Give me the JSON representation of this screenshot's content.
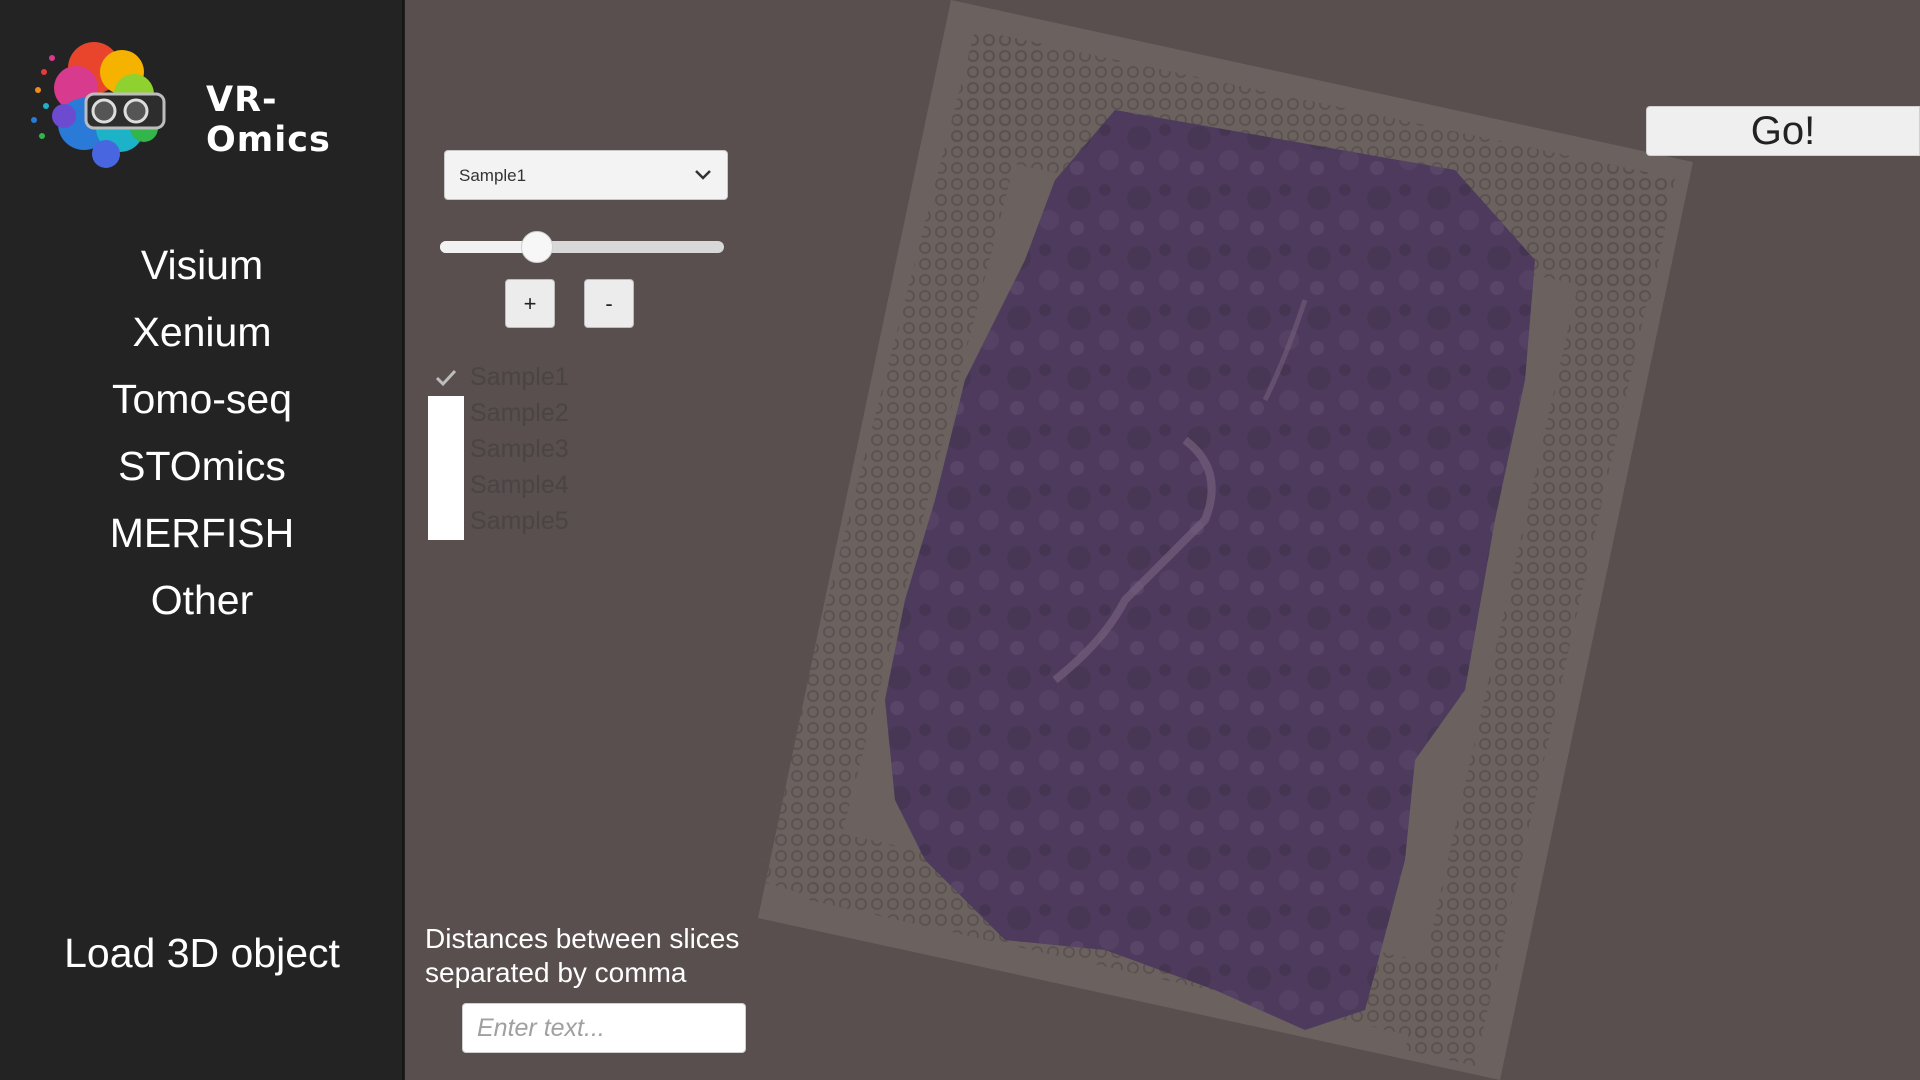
{
  "app": {
    "title": "VR-Omics",
    "logo_icon": "brain-vr-headset-logo-icon"
  },
  "sidebar": {
    "items": [
      {
        "label": "Visium"
      },
      {
        "label": "Xenium"
      },
      {
        "label": "Tomo-seq"
      },
      {
        "label": "STOmics"
      },
      {
        "label": "MERFISH"
      },
      {
        "label": "Other"
      }
    ],
    "load_label": "Load 3D object"
  },
  "controls": {
    "dropdown": {
      "selected": "Sample1",
      "icon": "chevron-down-icon"
    },
    "slider": {
      "value_fraction": 0.34
    },
    "plus_label": "+",
    "minus_label": "-",
    "samples": [
      {
        "label": "Sample1",
        "checked": true
      },
      {
        "label": "Sample2",
        "checked": false
      },
      {
        "label": "Sample3",
        "checked": false
      },
      {
        "label": "Sample4",
        "checked": false
      },
      {
        "label": "Sample5",
        "checked": false
      }
    ],
    "distances_label_line1": "Distances between slices",
    "distances_label_line2": "separated by comma",
    "distances_input": {
      "value": "",
      "placeholder": "Enter text..."
    },
    "go_label": "Go!"
  },
  "colors": {
    "sidebar_bg": "#232323",
    "main_bg": "#584f4e",
    "slide_bg": "#6b6260",
    "tissue": "#4e3a5c"
  }
}
